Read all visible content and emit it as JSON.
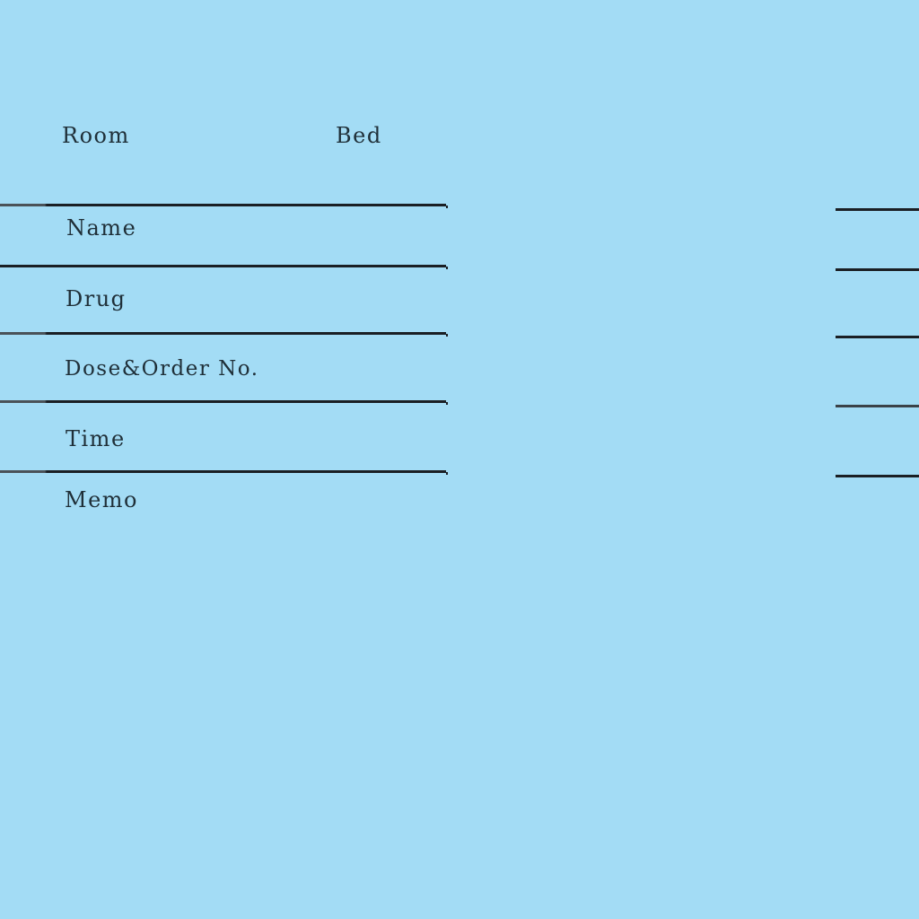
{
  "header": {
    "room_label": "Room",
    "bed_label": "Bed"
  },
  "fields": {
    "name_label": "Name",
    "drug_label": "Drug",
    "dose_label": "Dose&Order No.",
    "time_label": "Time",
    "memo_label": "Memo"
  },
  "colors": {
    "background": "#a3dcf5",
    "text": "#1f2f38",
    "rule": "#1a1f24"
  }
}
